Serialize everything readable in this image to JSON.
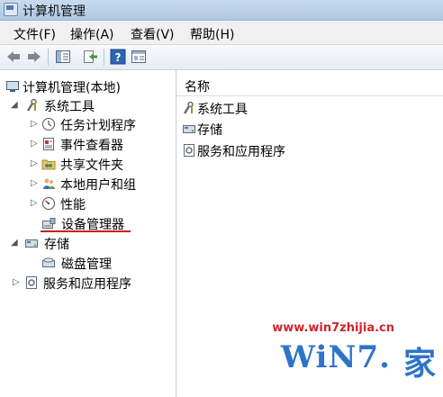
{
  "window": {
    "title": "计算机管理"
  },
  "menu": [
    "文件(F)",
    "操作(A)",
    "查看(V)",
    "帮助(H)"
  ],
  "toolbar": {
    "buttons": [
      "back-icon",
      "forward-icon",
      "show-hide-tree-icon",
      "export-list-icon",
      "help-icon",
      "properties-icon"
    ]
  },
  "tree": {
    "root": "计算机管理(本地)",
    "system_tools": "系统工具",
    "task_scheduler": "任务计划程序",
    "event_viewer": "事件查看器",
    "shared_folders": "共享文件夹",
    "local_users": "本地用户和组",
    "performance": "性能",
    "device_manager": "设备管理器",
    "storage": "存储",
    "disk_management": "磁盘管理",
    "services_apps": "服务和应用程序"
  },
  "list": {
    "header": "名称",
    "items": [
      "系统工具",
      "存储",
      "服务和应用程序"
    ]
  },
  "watermark": {
    "url": "www.win7zhijia.cn",
    "logo": "WiN7.",
    "logo_suffix": "家"
  }
}
